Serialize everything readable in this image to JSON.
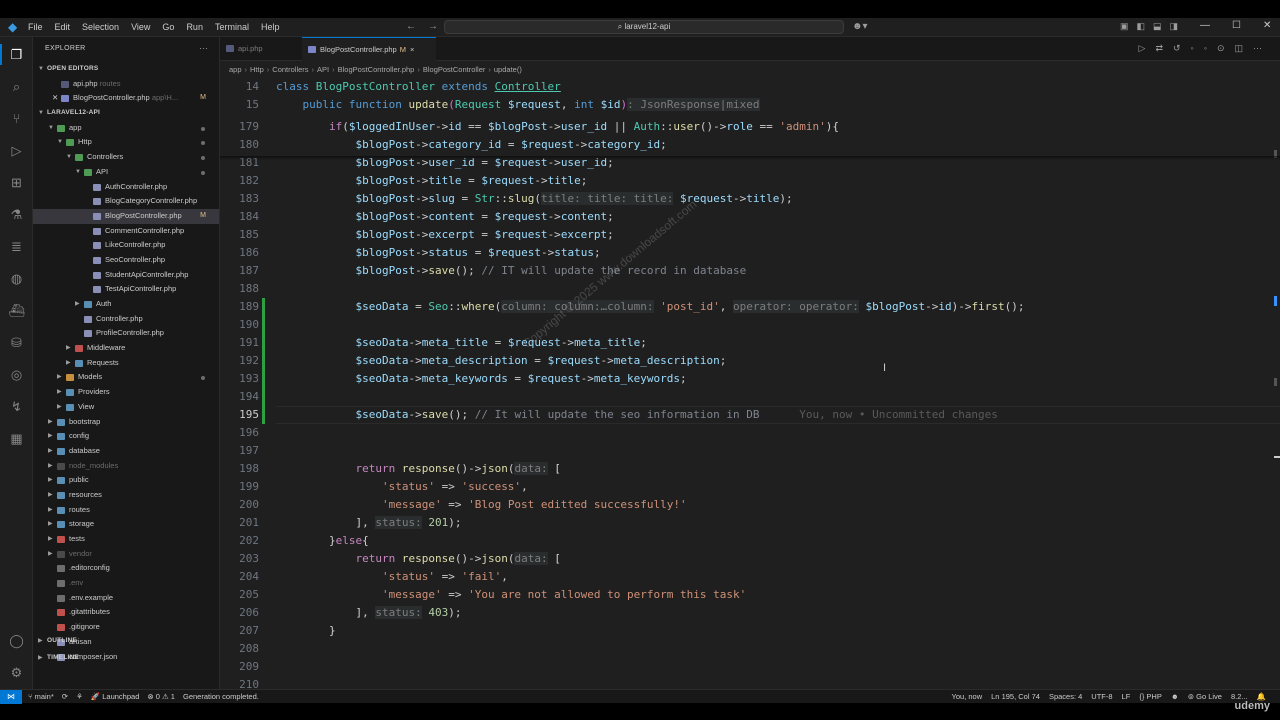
{
  "menu": [
    "File",
    "Edit",
    "Selection",
    "View",
    "Go",
    "Run",
    "Terminal",
    "Help"
  ],
  "command_center": "laravel12-api",
  "explorer": {
    "title": "EXPLORER",
    "open_editors_label": "OPEN EDITORS",
    "open_editors": [
      {
        "name": "api.php",
        "hint": "routes"
      },
      {
        "name": "BlogPostController.php",
        "hint": "app\\H...",
        "badge": "M"
      }
    ],
    "project_label": "LARAVEL12-API",
    "tree": [
      {
        "name": "app",
        "depth": 1,
        "folder": true,
        "open": true,
        "dot": true
      },
      {
        "name": "Http",
        "depth": 2,
        "folder": true,
        "open": true,
        "dot": true
      },
      {
        "name": "Controllers",
        "depth": 3,
        "folder": true,
        "open": true,
        "dot": true
      },
      {
        "name": "API",
        "depth": 4,
        "folder": true,
        "open": true,
        "dot": true
      },
      {
        "name": "AuthController.php",
        "depth": 5
      },
      {
        "name": "BlogCategoryController.php",
        "depth": 5
      },
      {
        "name": "BlogPostController.php",
        "depth": 5,
        "sel": true,
        "badge": "M"
      },
      {
        "name": "CommentController.php",
        "depth": 5
      },
      {
        "name": "LikeController.php",
        "depth": 5
      },
      {
        "name": "SeoController.php",
        "depth": 5
      },
      {
        "name": "StudentApiController.php",
        "depth": 5
      },
      {
        "name": "TestApiController.php",
        "depth": 5
      },
      {
        "name": "Auth",
        "depth": 4,
        "folder": true
      },
      {
        "name": "Controller.php",
        "depth": 4
      },
      {
        "name": "ProfileController.php",
        "depth": 4
      },
      {
        "name": "Middleware",
        "depth": 3,
        "folder": true
      },
      {
        "name": "Requests",
        "depth": 3,
        "folder": true
      },
      {
        "name": "Models",
        "depth": 2,
        "folder": true,
        "dot": true
      },
      {
        "name": "Providers",
        "depth": 2,
        "folder": true
      },
      {
        "name": "View",
        "depth": 2,
        "folder": true
      },
      {
        "name": "bootstrap",
        "depth": 1,
        "folder": true
      },
      {
        "name": "config",
        "depth": 1,
        "folder": true
      },
      {
        "name": "database",
        "depth": 1,
        "folder": true
      },
      {
        "name": "node_modules",
        "depth": 1,
        "folder": true,
        "dim": true
      },
      {
        "name": "public",
        "depth": 1,
        "folder": true
      },
      {
        "name": "resources",
        "depth": 1,
        "folder": true
      },
      {
        "name": "routes",
        "depth": 1,
        "folder": true
      },
      {
        "name": "storage",
        "depth": 1,
        "folder": true
      },
      {
        "name": "tests",
        "depth": 1,
        "folder": true
      },
      {
        "name": "vendor",
        "depth": 1,
        "folder": true,
        "dim": true
      },
      {
        "name": ".editorconfig",
        "depth": 1
      },
      {
        "name": ".env",
        "depth": 1,
        "dim": true
      },
      {
        "name": ".env.example",
        "depth": 1
      },
      {
        "name": ".gitattributes",
        "depth": 1
      },
      {
        "name": ".gitignore",
        "depth": 1
      },
      {
        "name": "artisan",
        "depth": 1
      },
      {
        "name": "composer.json",
        "depth": 1
      }
    ],
    "outline_label": "OUTLINE",
    "timeline_label": "TIMELINE"
  },
  "tabs": [
    {
      "name": "api.php"
    },
    {
      "name": "BlogPostController.php",
      "badge": "M",
      "close": "×"
    }
  ],
  "breadcrumb": [
    "app",
    "Http",
    "Controllers",
    "API",
    "BlogPostController.php",
    "BlogPostController",
    "update()"
  ],
  "code": {
    "sticky": [
      {
        "ln": "14",
        "html": "<span class='kw'>class</span> <span class='cls'>BlogPostController</span> <span class='kw'>extends</span> <span class='cls' style='text-decoration:underline'>Controller</span>"
      },
      {
        "ln": "15",
        "html": "    <span class='kw'>public</span> <span class='kw'>function</span> <span class='fn'>update</span><span class='pb'>(</span><span class='cls'>Request</span> <span class='v'>$request</span>, <span class='kw'>int</span> <span class='v'>$id</span><span class='pb'>)</span><span class='h'>: JsonResponse|mixed</span>"
      }
    ],
    "lines": [
      {
        "ln": "179",
        "html": "        <span class='k'>if</span>(<span class='v'>$loggedInUser</span>-><span class='v'>id</span> == <span class='v'>$blogPost</span>-><span class='v'>user_id</span> || <span class='cls'>Auth</span>::<span class='fn'>user</span>()-><span class='v'>role</span> == <span class='s'>'admin'</span>)<span class='o'>{</span>"
      },
      {
        "ln": "180",
        "html": "            <span class='v'>$blogPost</span>-><span class='v'>category_id</span> = <span class='v'>$request</span>-><span class='v'>category_id</span>;"
      },
      {
        "ln": "181",
        "html": "            <span class='v'>$blogPost</span>-><span class='v'>user_id</span> = <span class='v'>$request</span>-><span class='v'>user_id</span>;"
      },
      {
        "ln": "182",
        "html": "            <span class='v'>$blogPost</span>-><span class='v'>title</span> = <span class='v'>$request</span>-><span class='v'>title</span>;"
      },
      {
        "ln": "183",
        "html": "            <span class='v'>$blogPost</span>-><span class='v'>slug</span> = <span class='cls'>Str</span>::<span class='fn'>slug</span>(<span class='h'>title: title: title:</span> <span class='v'>$request</span>-><span class='v'>title</span>);"
      },
      {
        "ln": "184",
        "html": "            <span class='v'>$blogPost</span>-><span class='v'>content</span> = <span class='v'>$request</span>-><span class='v'>content</span>;"
      },
      {
        "ln": "185",
        "html": "            <span class='v'>$blogPost</span>-><span class='v'>excerpt</span> = <span class='v'>$request</span>-><span class='v'>excerpt</span>;"
      },
      {
        "ln": "186",
        "html": "            <span class='v'>$blogPost</span>-><span class='v'>status</span> = <span class='v'>$request</span>-><span class='v'>status</span>;"
      },
      {
        "ln": "187",
        "html": "            <span class='v'>$blogPost</span>-><span class='fn'>save</span>(); <span class='cm'>// IT will update the record in database</span>"
      },
      {
        "ln": "188",
        "html": ""
      },
      {
        "ln": "189",
        "html": "            <span class='v'>$seoData</span> = <span class='cls'>Seo</span>::<span class='fn'>where</span>(<span class='h'>column: column:…column:</span> <span class='s'>'post_id'</span>, <span class='h'>operator: operator:</span> <span class='v'>$blogPost</span>-><span class='v'>id</span>)-><span class='fn'>first</span>();"
      },
      {
        "ln": "190",
        "html": ""
      },
      {
        "ln": "191",
        "html": "            <span class='v'>$seoData</span>-><span class='v'>meta_title</span> = <span class='v'>$request</span>-><span class='v'>meta_title</span>;"
      },
      {
        "ln": "192",
        "html": "            <span class='v'>$seoData</span>-><span class='v'>meta_description</span> = <span class='v'>$request</span>-><span class='v'>meta_description</span>;"
      },
      {
        "ln": "193",
        "html": "            <span class='v'>$seoData</span>-><span class='v'>meta_keywords</span> = <span class='v'>$request</span>-><span class='v'>meta_keywords</span>;"
      },
      {
        "ln": "194",
        "html": ""
      },
      {
        "ln": "195",
        "html": "            <span class='v'>$seoData</span>-><span class='fn'>save</span>(); <span class='cm'>// It will update the seo information in DB</span>      <span class='blame'>You, now • Uncommitted changes</span>",
        "cur": true
      },
      {
        "ln": "196",
        "html": ""
      },
      {
        "ln": "197",
        "html": ""
      },
      {
        "ln": "198",
        "html": "            <span class='k'>return</span> <span class='fn'>response</span>()-><span class='fn'>json</span>(<span class='h'>data:</span> <span class='o'>[</span>"
      },
      {
        "ln": "199",
        "html": "                <span class='s'>'status'</span> => <span class='s'>'success'</span>,"
      },
      {
        "ln": "200",
        "html": "                <span class='s'>'message'</span> => <span class='s'>'Blog Post editted successfully!'</span>"
      },
      {
        "ln": "201",
        "html": "            <span class='o'>]</span>, <span class='h'>status:</span> <span class='n'>201</span>);"
      },
      {
        "ln": "202",
        "html": "        <span class='o'>}</span><span class='k'>else</span><span class='o'>{</span>"
      },
      {
        "ln": "203",
        "html": "            <span class='k'>return</span> <span class='fn'>response</span>()-><span class='fn'>json</span>(<span class='h'>data:</span> <span class='o'>[</span>"
      },
      {
        "ln": "204",
        "html": "                <span class='s'>'status'</span> => <span class='s'>'fail'</span>,"
      },
      {
        "ln": "205",
        "html": "                <span class='s'>'message'</span> => <span class='s'>'You are not allowed to perform this task'</span>"
      },
      {
        "ln": "206",
        "html": "            <span class='o'>]</span>, <span class='h'>status:</span> <span class='n'>403</span>);"
      },
      {
        "ln": "207",
        "html": "        <span class='o'>}</span>"
      },
      {
        "ln": "208",
        "html": ""
      },
      {
        "ln": "209",
        "html": ""
      },
      {
        "ln": "210",
        "html": ""
      }
    ]
  },
  "watermark": "Copyright © 2025 www.downloadsoft.com",
  "status": {
    "branch": "main*",
    "launchpad": "Launchpad",
    "problems": "⊗ 0 ⚠ 1",
    "message": "Generation completed.",
    "blame": "You, now",
    "position": "Ln 195, Col 74",
    "spaces": "Spaces: 4",
    "encoding": "UTF-8",
    "eol": "LF",
    "language": "PHP",
    "golive": "Go Live",
    "extra": "8.2..."
  },
  "brand": "udemy"
}
